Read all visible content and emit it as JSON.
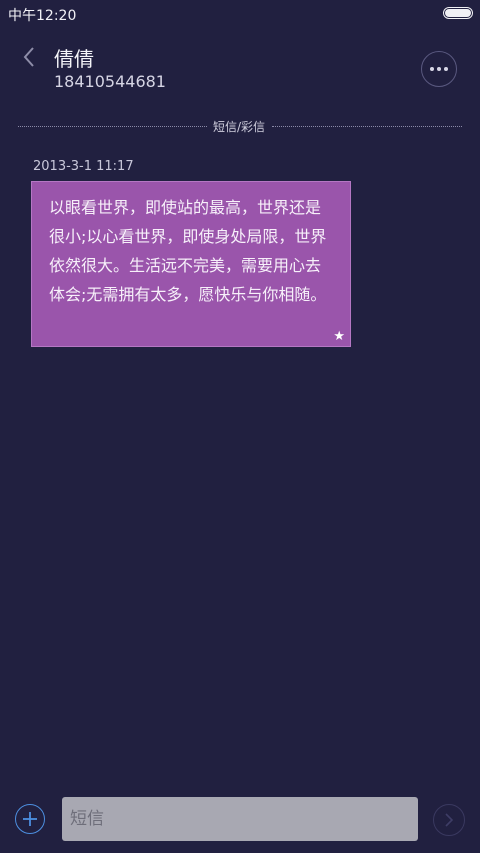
{
  "status_bar": {
    "time": "中午12:20",
    "battery_level": 1.0
  },
  "header": {
    "contact_name": "倩倩",
    "contact_number": "18410544681",
    "back_icon": "chevron-left-icon",
    "more_icon": "more-dots-icon"
  },
  "divider": {
    "label": "短信/彩信"
  },
  "messages": [
    {
      "timestamp": "2013-3-1 11:17",
      "text": "以眼看世界，即使站的最高，世界还是很小;以心看世界，即使身处局限，世界依然很大。生活远不完美，需要用心去体会;无需拥有太多，愿快乐与你相随。",
      "starred": true,
      "star_glyph": "★"
    }
  ],
  "compose": {
    "placeholder": "短信",
    "value": "",
    "add_icon": "plus-icon",
    "send_icon": "chevron-right-icon"
  },
  "colors": {
    "background": "#212040",
    "bubble": "#9a55ab",
    "accent": "#4d8fe0",
    "input": "#a8a8b2"
  }
}
